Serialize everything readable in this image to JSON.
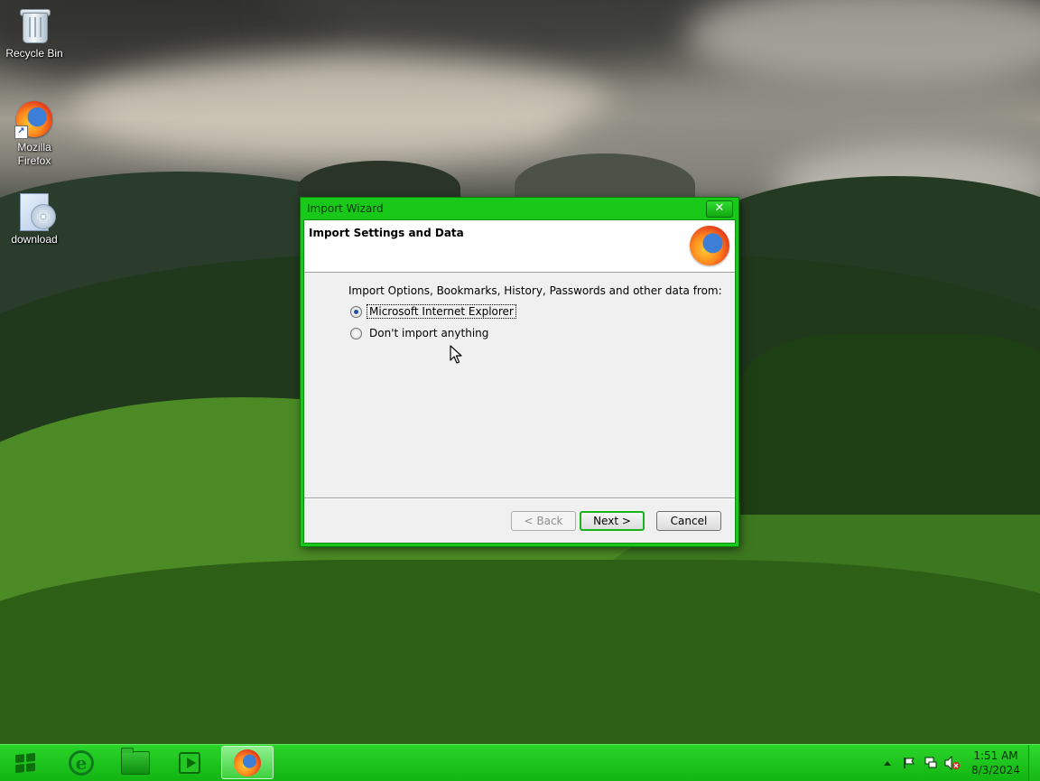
{
  "desktop": {
    "icons": [
      {
        "label": "Recycle Bin"
      },
      {
        "label": "Mozilla Firefox"
      },
      {
        "label": "download"
      }
    ]
  },
  "dialog": {
    "title": "Import Wizard",
    "close_glyph": "✕",
    "header_title": "Import Settings and Data",
    "prompt": "Import Options, Bookmarks, History, Passwords and other data from:",
    "options": [
      {
        "label": "Microsoft Internet Explorer",
        "selected": true
      },
      {
        "label": "Don't import anything",
        "selected": false
      }
    ],
    "buttons": {
      "back": "< Back",
      "next": "Next >",
      "cancel": "Cancel"
    },
    "accent_color": "#19c919"
  },
  "taskbar": {
    "color": "#19c119",
    "items": [
      {
        "icon": "start-orb-icon"
      },
      {
        "icon": "internet-explorer-icon"
      },
      {
        "icon": "file-explorer-icon"
      },
      {
        "icon": "media-player-icon"
      },
      {
        "icon": "firefox-icon",
        "active": true
      }
    ],
    "tray": {
      "time": "1:51 AM",
      "date": "8/3/2024",
      "icons": [
        "show-hidden-icons-icon",
        "action-center-flag-icon",
        "network-icon",
        "volume-muted-icon"
      ]
    }
  }
}
